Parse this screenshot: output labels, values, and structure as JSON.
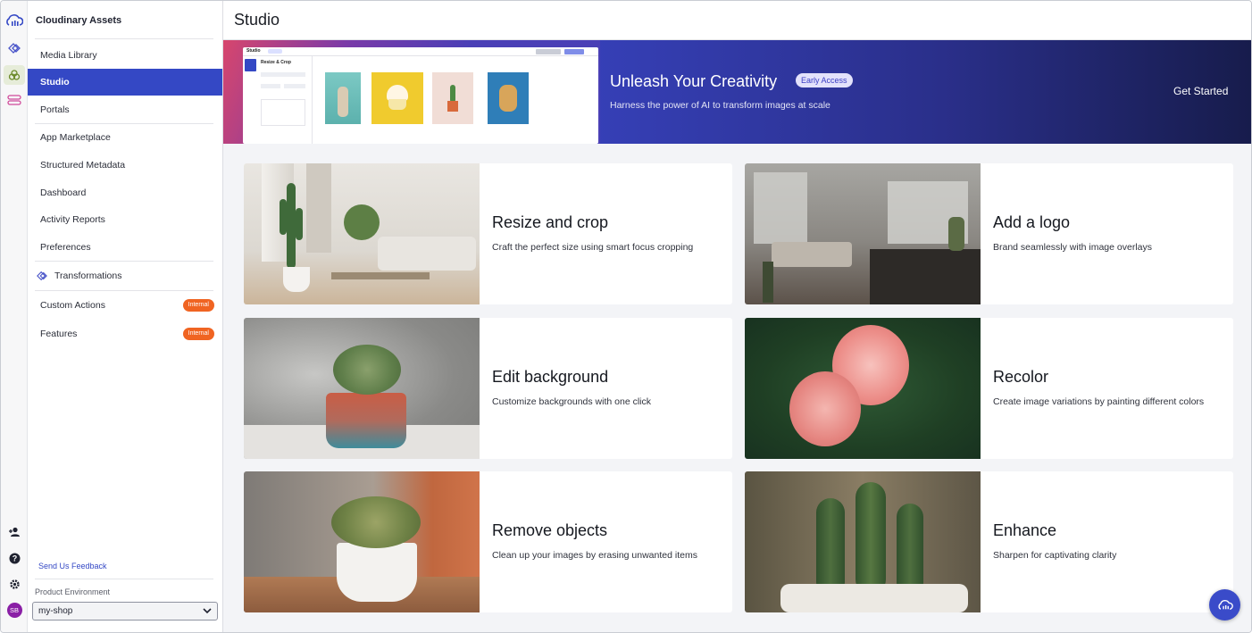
{
  "app": {
    "title": "Cloudinary Assets"
  },
  "sidebar": {
    "items": [
      {
        "label": "Media Library"
      },
      {
        "label": "Studio"
      },
      {
        "label": "Portals"
      },
      {
        "label": "App Marketplace"
      },
      {
        "label": "Structured Metadata"
      },
      {
        "label": "Dashboard"
      },
      {
        "label": "Activity Reports"
      },
      {
        "label": "Preferences"
      },
      {
        "label": "Transformations"
      },
      {
        "label": "Custom Actions",
        "badge": "Internal"
      },
      {
        "label": "Features",
        "badge": "Internal"
      }
    ],
    "feedback": "Send Us Feedback",
    "env_label": "Product Environment",
    "env_value": "my-shop",
    "avatar": "SB"
  },
  "page": {
    "title": "Studio"
  },
  "banner": {
    "title": "Unleash Your Creativity",
    "badge": "Early Access",
    "subtitle": "Harness the power of AI to transform images at scale",
    "cta": "Get Started",
    "mock": {
      "app_label": "Studio",
      "panel_title": "Resize & Crop"
    }
  },
  "cards": [
    {
      "title": "Resize and crop",
      "desc": "Craft the perfect size using smart focus cropping"
    },
    {
      "title": "Add a logo",
      "desc": "Brand seamlessly with image overlays"
    },
    {
      "title": "Edit background",
      "desc": "Customize backgrounds with one click"
    },
    {
      "title": "Recolor",
      "desc": "Create image variations by painting different colors"
    },
    {
      "title": "Remove objects",
      "desc": "Clean up your images by erasing unwanted items"
    },
    {
      "title": "Enhance",
      "desc": "Sharpen for captivating clarity"
    }
  ],
  "colors": {
    "accent": "#3448c5",
    "badge": "#f06422",
    "banner_dark": "#171c4c"
  }
}
